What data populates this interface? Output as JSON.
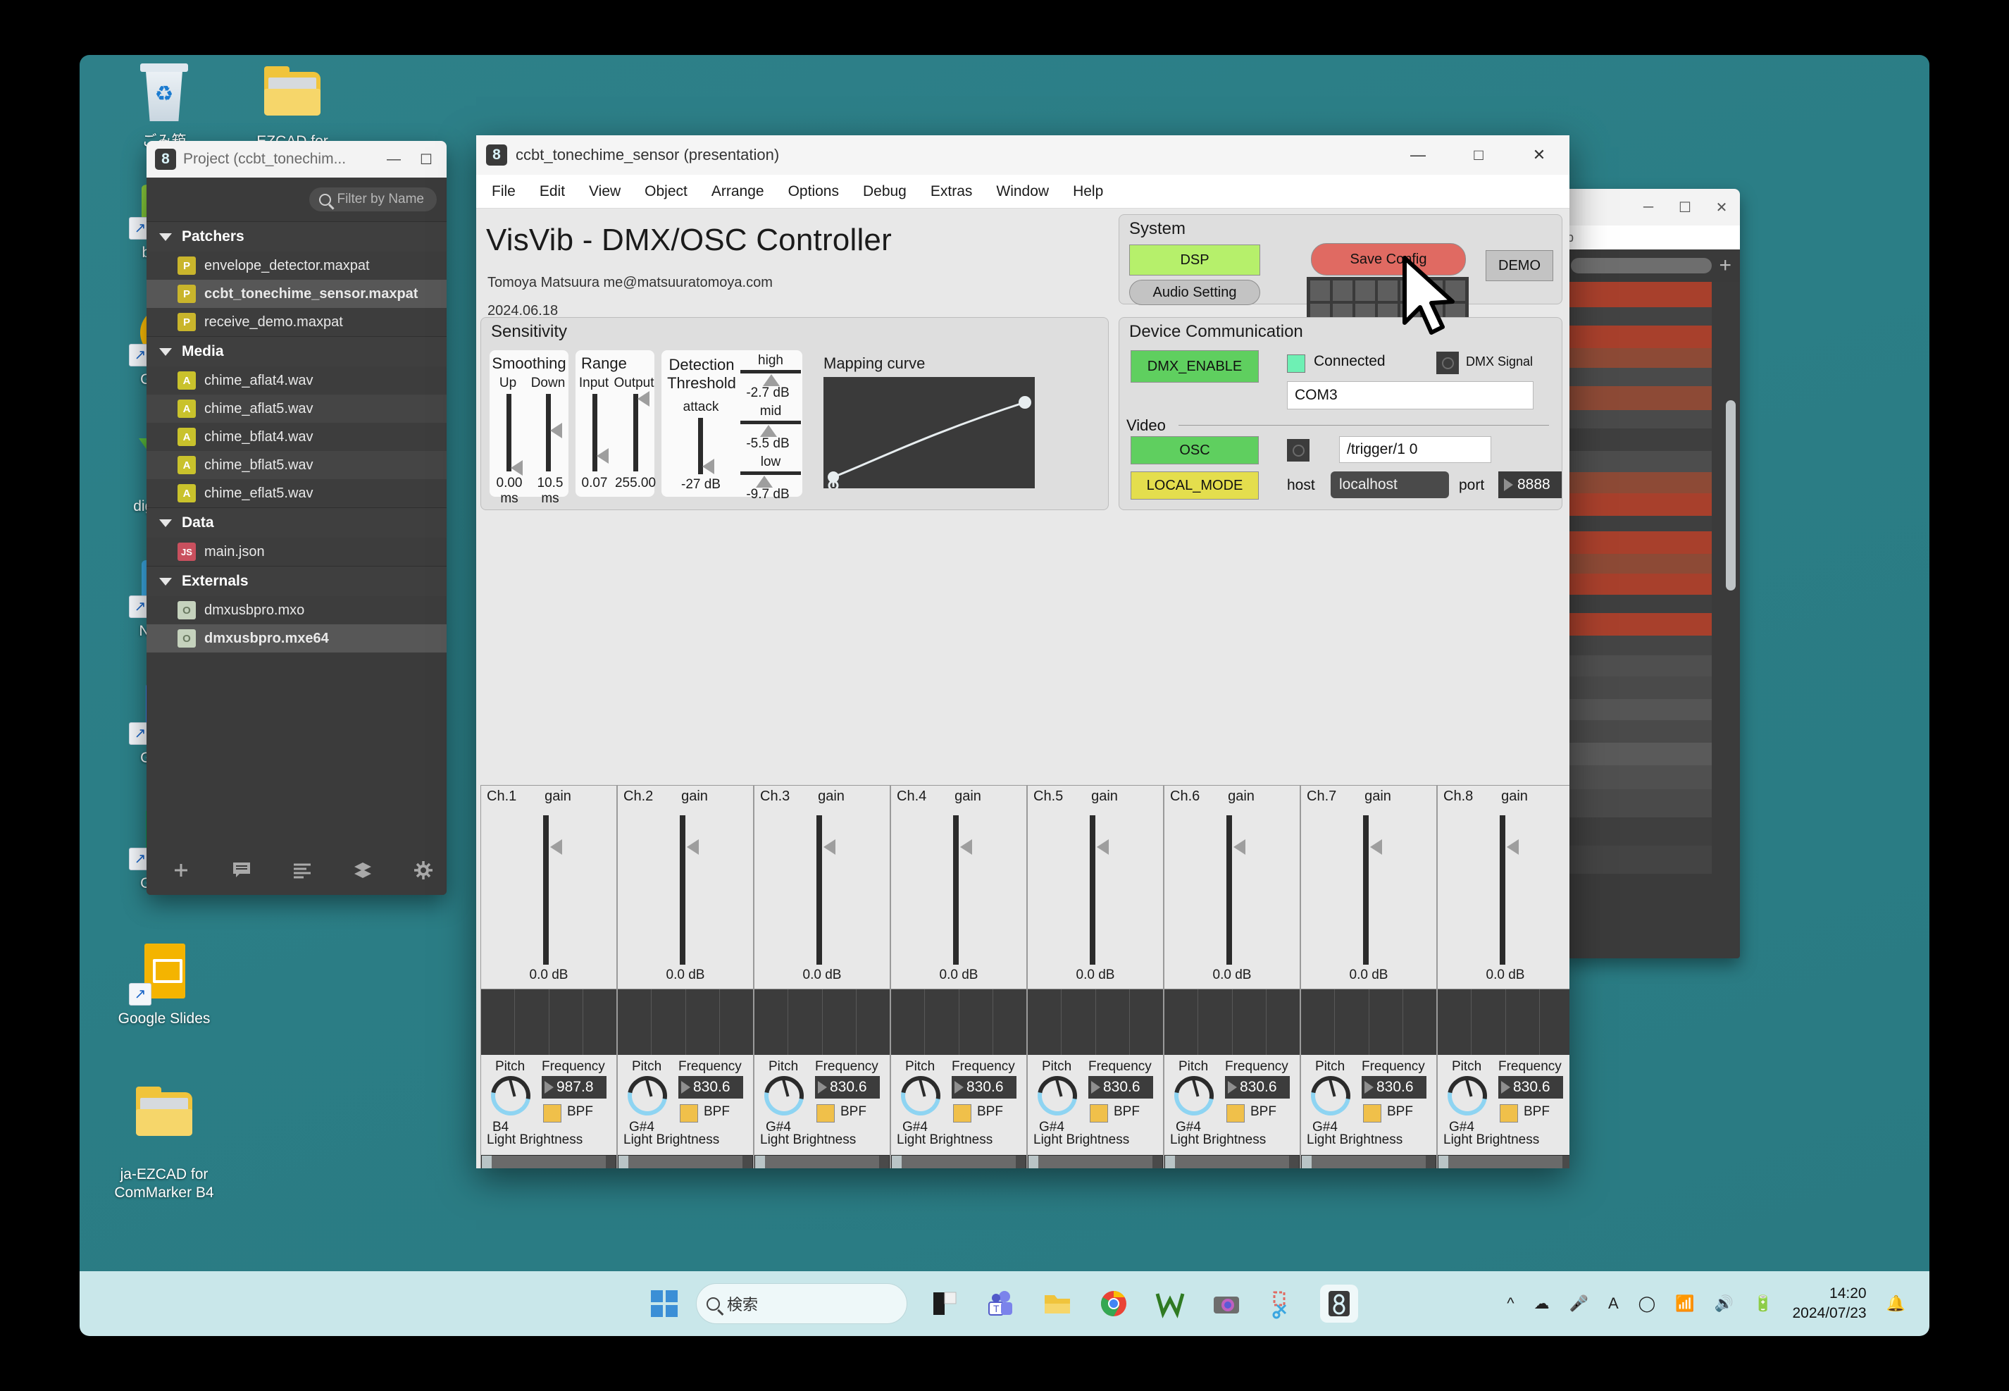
{
  "desktop": {
    "icons": [
      {
        "label": "ごみ箱",
        "glyph": "recycle-bin"
      },
      {
        "label": "EZCAD for",
        "glyph": "folder"
      },
      {
        "label": "balena",
        "glyph": "balena"
      },
      {
        "label": "Google",
        "glyph": "chrome"
      },
      {
        "label": "digilent.w",
        "glyph": "digilent"
      },
      {
        "label": "Nextion",
        "glyph": "nextion"
      },
      {
        "label": "Google",
        "glyph": "google-docs"
      },
      {
        "label": "Google",
        "glyph": "google-sheets"
      },
      {
        "label": "Google Slides",
        "glyph": "google-slides"
      },
      {
        "label": "ja-EZCAD for\nComMarker B4",
        "glyph": "folder-media"
      }
    ]
  },
  "project_window": {
    "title": "Project (ccbt_tonechim...",
    "minimize": "—",
    "maximize": "☐",
    "search_placeholder": "Filter by Name",
    "groups": [
      {
        "name": "Patchers",
        "files": [
          {
            "name": "envelope_detector.maxpat",
            "kind": "P",
            "selected": false
          },
          {
            "name": "ccbt_tonechime_sensor.maxpat",
            "kind": "P",
            "selected": true
          },
          {
            "name": "receive_demo.maxpat",
            "kind": "P",
            "selected": false
          }
        ]
      },
      {
        "name": "Media",
        "files": [
          {
            "name": "chime_aflat4.wav",
            "kind": "A",
            "selected": false
          },
          {
            "name": "chime_aflat5.wav",
            "kind": "A",
            "selected": false
          },
          {
            "name": "chime_bflat4.wav",
            "kind": "A",
            "selected": false
          },
          {
            "name": "chime_bflat5.wav",
            "kind": "A",
            "selected": false
          },
          {
            "name": "chime_eflat5.wav",
            "kind": "A",
            "selected": false
          }
        ]
      },
      {
        "name": "Data",
        "files": [
          {
            "name": "main.json",
            "kind": "JS",
            "selected": false
          }
        ]
      },
      {
        "name": "Externals",
        "files": [
          {
            "name": "dmxusbpro.mxo",
            "kind": "O",
            "selected": false
          },
          {
            "name": "dmxusbpro.mxe64",
            "kind": "O",
            "selected": true
          }
        ]
      }
    ],
    "tools": [
      "add-icon",
      "comment-icon",
      "list-icon",
      "layers-icon",
      "gear-icon",
      "refresh-icon"
    ]
  },
  "max_window": {
    "title": "ccbt_tonechime_sensor (presentation)",
    "window_buttons": {
      "minimize": "—",
      "maximize": "□",
      "close": "✕"
    },
    "menus": [
      "File",
      "Edit",
      "View",
      "Object",
      "Arrange",
      "Options",
      "Debug",
      "Extras",
      "Window",
      "Help"
    ],
    "app_title": "VisVib - DMX/OSC Controller",
    "author": "Tomoya Matsuura me@matsuuratomoya.com",
    "date": "2024.06.18",
    "system": {
      "title": "System",
      "dsp_label": "DSP",
      "audio_setting_label": "Audio Setting",
      "save_config_label": "Save Config",
      "demo_label": "DEMO",
      "dsp_color": "#b6f06b",
      "save_color": "#e06a62"
    },
    "sensitivity": {
      "title": "Sensitivity",
      "smoothing": {
        "title": "Smoothing",
        "up_label": "Up",
        "down_label": "Down",
        "up_value": "0.00 ms",
        "down_value": "10.5 ms",
        "up_pos": 0.96,
        "down_pos": 0.42
      },
      "range": {
        "title": "Range",
        "input_label": "Input",
        "output_label": "Output",
        "input_value": "0.07",
        "output_value": "255.00",
        "input_pos": 0.72,
        "output_pos": 0.04
      },
      "detection": {
        "title_line1": "Detection",
        "title_line2": "Threshold",
        "attack_label": "attack",
        "attack_value": "-27 dB",
        "attack_pos": 0.85,
        "bands": [
          {
            "label": "high",
            "value": "-2.7 dB"
          },
          {
            "label": "mid",
            "value": "-5.5 dB"
          },
          {
            "label": "low",
            "value": "-9.7 dB"
          }
        ]
      },
      "mapping": {
        "title": "Mapping curve"
      }
    },
    "device_comm": {
      "title": "Device Communication",
      "dmx_enable_label": "DMX_ENABLE",
      "connected_label": "Connected",
      "dmx_signal_label": "DMX Signal",
      "port_value": "COM3",
      "video_title": "Video",
      "osc_label": "OSC",
      "local_mode_label": "LOCAL_MODE",
      "osc_message": "/trigger/1 0",
      "host_label": "host",
      "host_value": "localhost",
      "port_label": "port",
      "port_number": "8888",
      "enable_color": "#5fcf5f",
      "local_color": "#e4de4d",
      "connected_color": "#6ef0b4"
    },
    "channels_common": {
      "gain_label": "gain",
      "pitch_label": "Pitch",
      "frequency_label": "Frequency",
      "bpf_label": "BPF",
      "light_brightness_label": "Light Brightness",
      "video_label": "Video",
      "bpf_color": "#f0c04a",
      "video_lines": [
        "#c4504a",
        "#c3d24e",
        "#67c34e"
      ]
    },
    "channels": [
      {
        "name": "Ch.1",
        "gain": "0.0 dB",
        "note": "B4",
        "freq": "987.8"
      },
      {
        "name": "Ch.2",
        "gain": "0.0 dB",
        "note": "G#4",
        "freq": "830.6"
      },
      {
        "name": "Ch.3",
        "gain": "0.0 dB",
        "note": "G#4",
        "freq": "830.6"
      },
      {
        "name": "Ch.4",
        "gain": "0.0 dB",
        "note": "G#4",
        "freq": "830.6"
      },
      {
        "name": "Ch.5",
        "gain": "0.0 dB",
        "note": "G#4",
        "freq": "830.6"
      },
      {
        "name": "Ch.6",
        "gain": "0.0 dB",
        "note": "G#4",
        "freq": "830.6"
      },
      {
        "name": "Ch.7",
        "gain": "0.0 dB",
        "note": "G#4",
        "freq": "830.6"
      },
      {
        "name": "Ch.8",
        "gain": "0.0 dB",
        "note": "G#4",
        "freq": "830.6"
      }
    ]
  },
  "taskbar": {
    "search_placeholder": "検索",
    "time": "14:20",
    "date": "2024/07/23",
    "icons": [
      "windows-start-icon",
      "search-icon",
      "widgets-icon",
      "teams-icon",
      "file-explorer-icon",
      "chrome-icon",
      "w-icon",
      "camera-icon",
      "snip-icon",
      "max-icon"
    ],
    "tray": [
      "chevron-up-icon",
      "onedrive-off-icon",
      "microphone-icon",
      "ime-a-icon",
      "ime-mode-icon",
      "wifi-icon",
      "speaker-icon",
      "battery-icon",
      "bell-icon"
    ]
  }
}
